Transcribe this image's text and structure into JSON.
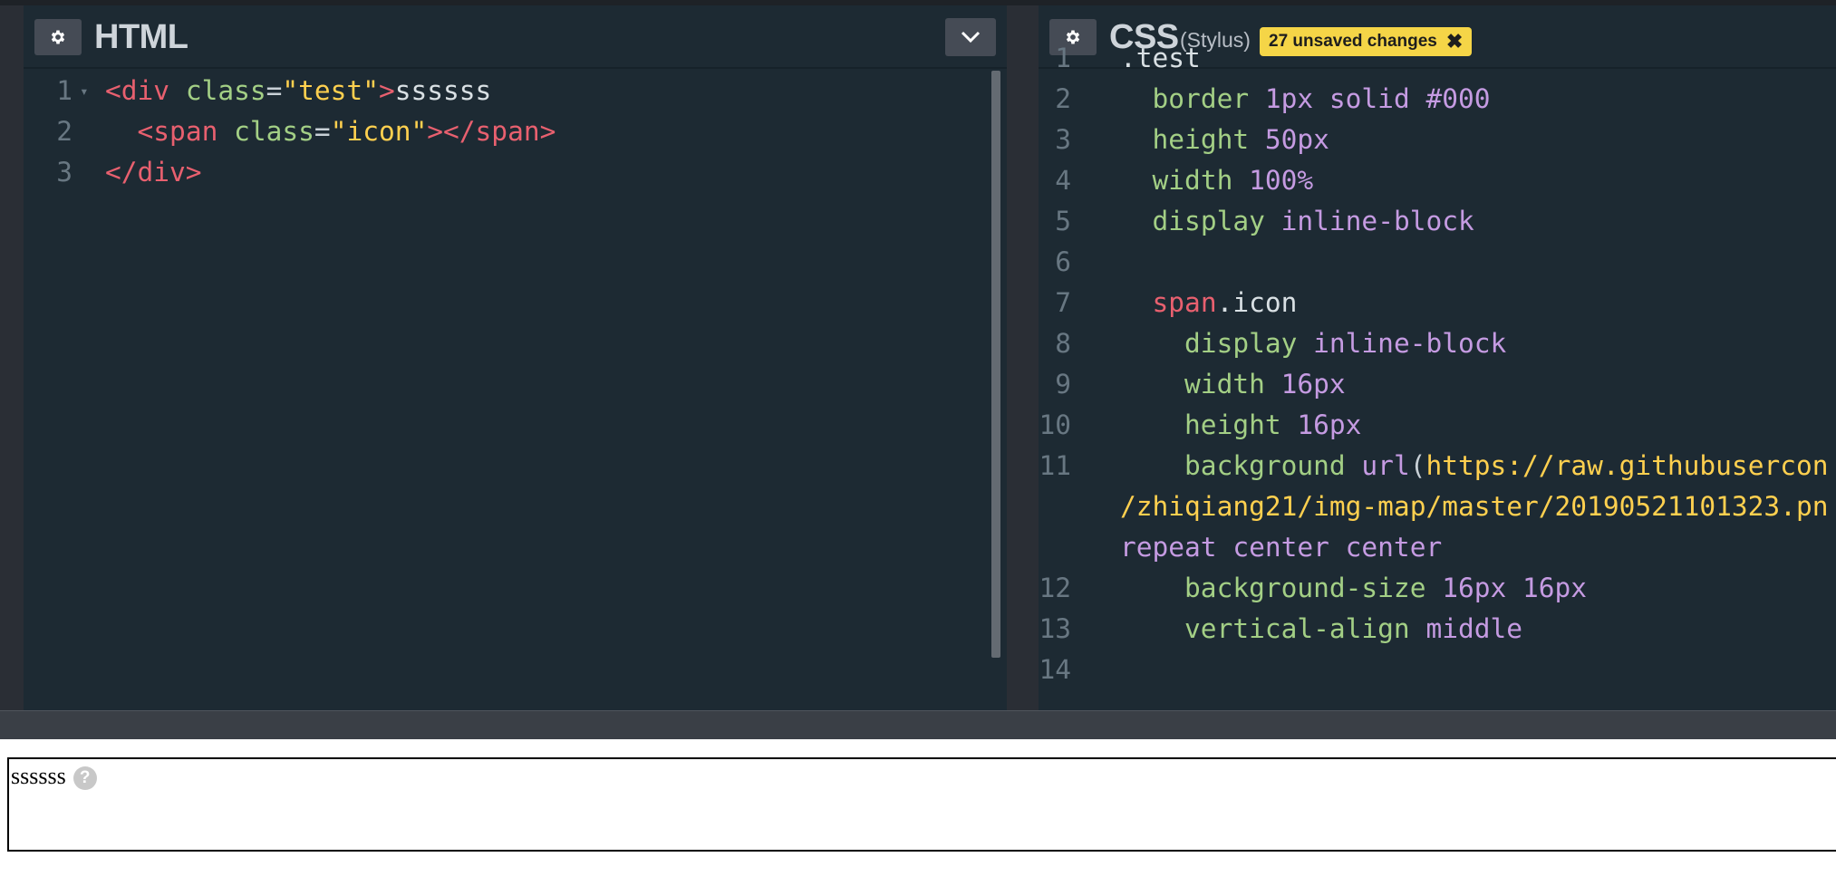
{
  "html_pane": {
    "title": "HTML",
    "lines": [
      {
        "n": "1",
        "parts": [
          [
            "tag",
            "<div "
          ],
          [
            "attr",
            "class"
          ],
          [
            "punc",
            "="
          ],
          [
            "str",
            "\"test\""
          ],
          [
            "tag",
            ">"
          ],
          [
            "plain",
            "ssssss"
          ]
        ]
      },
      {
        "n": "2",
        "parts": [
          [
            "plain",
            "  "
          ],
          [
            "tag",
            "<span "
          ],
          [
            "attr",
            "class"
          ],
          [
            "punc",
            "="
          ],
          [
            "str",
            "\"icon\""
          ],
          [
            "tag",
            "></span>"
          ]
        ]
      },
      {
        "n": "3",
        "parts": [
          [
            "tag",
            "</div>"
          ]
        ]
      }
    ]
  },
  "css_pane": {
    "title": "CSS",
    "preprocessor": "(Stylus)",
    "unsaved_label": "27 unsaved changes",
    "lines": [
      {
        "n": "1",
        "parts": [
          [
            "plain",
            ".test"
          ]
        ]
      },
      {
        "n": "2",
        "parts": [
          [
            "plain",
            "  "
          ],
          [
            "attr",
            "border "
          ],
          [
            "kw",
            "1px solid #000"
          ]
        ]
      },
      {
        "n": "3",
        "parts": [
          [
            "plain",
            "  "
          ],
          [
            "attr",
            "height "
          ],
          [
            "kw",
            "50px"
          ]
        ]
      },
      {
        "n": "4",
        "parts": [
          [
            "plain",
            "  "
          ],
          [
            "attr",
            "width "
          ],
          [
            "kw",
            "100%"
          ]
        ]
      },
      {
        "n": "5",
        "parts": [
          [
            "plain",
            "  "
          ],
          [
            "attr",
            "display "
          ],
          [
            "kw",
            "inline-block"
          ]
        ]
      },
      {
        "n": "6",
        "parts": []
      },
      {
        "n": "7",
        "parts": [
          [
            "plain",
            "  "
          ],
          [
            "sel",
            "span"
          ],
          [
            "plain",
            ".icon"
          ]
        ]
      },
      {
        "n": "8",
        "parts": [
          [
            "plain",
            "    "
          ],
          [
            "attr",
            "display "
          ],
          [
            "kw",
            "inline-block"
          ]
        ]
      },
      {
        "n": "9",
        "parts": [
          [
            "plain",
            "    "
          ],
          [
            "attr",
            "width "
          ],
          [
            "kw",
            "16px"
          ]
        ]
      },
      {
        "n": "10",
        "parts": [
          [
            "plain",
            "    "
          ],
          [
            "attr",
            "height "
          ],
          [
            "kw",
            "16px"
          ]
        ]
      },
      {
        "n": "11",
        "parts": [
          [
            "plain",
            "    "
          ],
          [
            "attr",
            "background "
          ],
          [
            "kw",
            "url"
          ],
          [
            "punc",
            "("
          ],
          [
            "str",
            "https://raw.githubusercon"
          ]
        ]
      },
      {
        "n": "",
        "parts": [
          [
            "str",
            "/zhiqiang21/img-map/master/20190521101323.pn"
          ]
        ]
      },
      {
        "n": "",
        "parts": [
          [
            "kw",
            "repeat center center"
          ]
        ]
      },
      {
        "n": "12",
        "parts": [
          [
            "plain",
            "    "
          ],
          [
            "attr",
            "background-size "
          ],
          [
            "kw",
            "16px 16px"
          ]
        ]
      },
      {
        "n": "13",
        "parts": [
          [
            "plain",
            "    "
          ],
          [
            "attr",
            "vertical-align "
          ],
          [
            "kw",
            "middle"
          ]
        ]
      },
      {
        "n": "14",
        "parts": []
      }
    ]
  },
  "preview": {
    "text": "ssssss",
    "icon_glyph": "?"
  },
  "colors": {
    "editor_bg": "#1d2a33",
    "badge": "#f5d547",
    "tag": "#e8606f",
    "attr": "#a3cf85",
    "string": "#ffd04f",
    "keyword": "#c59be2"
  }
}
